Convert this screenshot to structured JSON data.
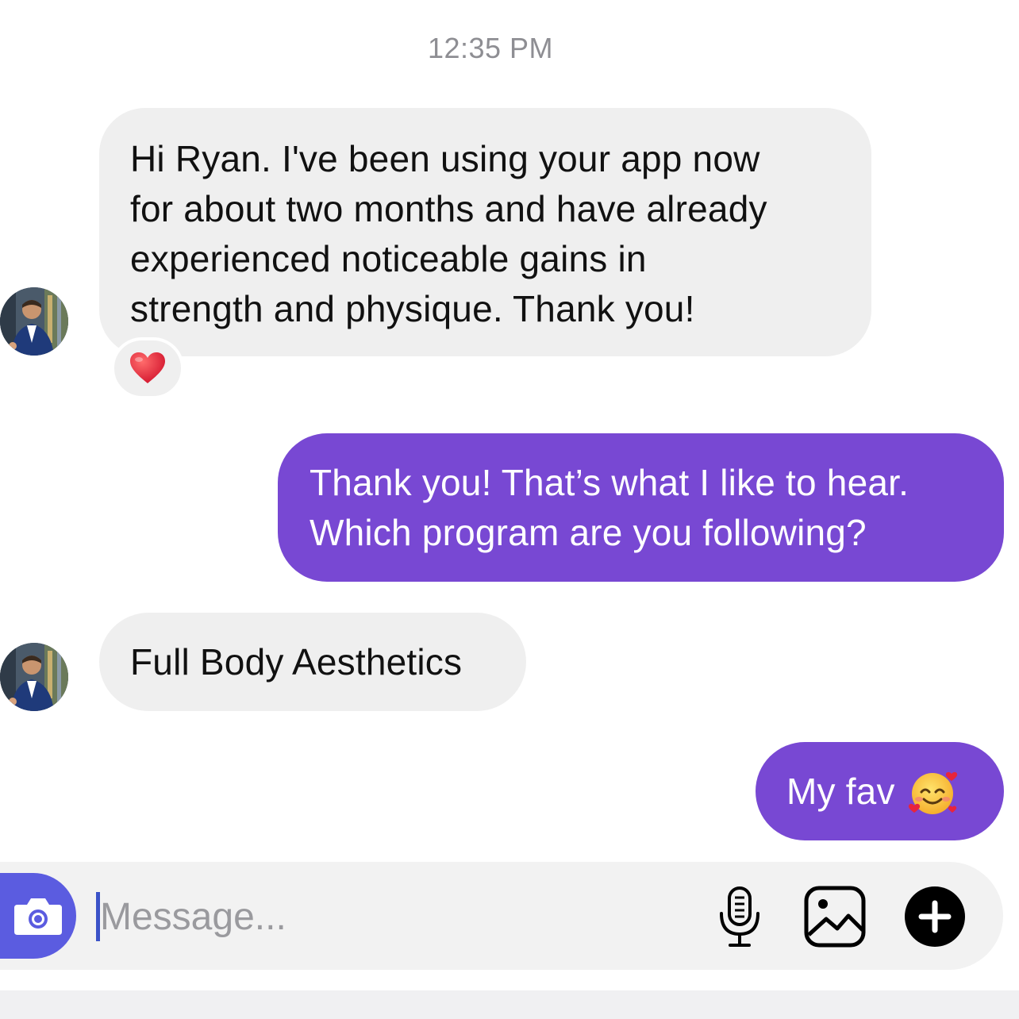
{
  "chat": {
    "timestamp": "12:35 PM",
    "messages": [
      {
        "direction": "incoming",
        "lines": [
          "Hi Ryan.  I've been using your app now",
          "for about two months and have already",
          "experienced noticeable gains in",
          "strength and physique.  Thank you!"
        ],
        "reaction": "red-heart"
      },
      {
        "direction": "outgoing",
        "lines": [
          "Thank you! That’s what I like to hear.",
          "Which program are you following?"
        ]
      },
      {
        "direction": "incoming",
        "lines": [
          "Full Body Aesthetics"
        ]
      },
      {
        "direction": "outgoing",
        "text": "My fav",
        "emoji": "smiling-face-with-hearts"
      }
    ]
  },
  "composer": {
    "placeholder": "Message...",
    "value": "",
    "icons": [
      "camera-icon",
      "microphone-icon",
      "gallery-icon",
      "plus-icon"
    ]
  },
  "colors": {
    "incoming_bubble": "#efefef",
    "outgoing_bubble": "#7848d3",
    "camera_button": "#5b5ce0",
    "timestamp": "#8e8e93"
  }
}
